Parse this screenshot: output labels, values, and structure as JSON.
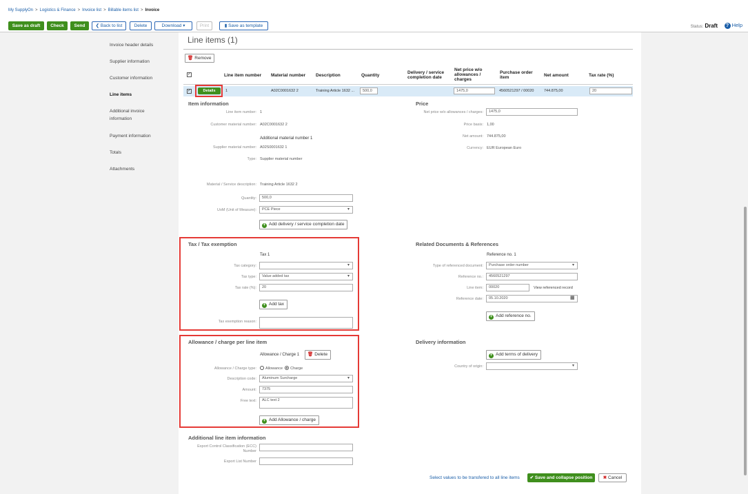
{
  "breadcrumb": {
    "items": [
      "My SupplyOn",
      "Logistics & Finance",
      "Invoice list",
      "Billable items list"
    ],
    "current": "Invoice"
  },
  "toolbar": {
    "save_draft": "Save as draft",
    "check": "Check",
    "send": "Send",
    "back": "Back to list",
    "delete": "Delete",
    "download": "Download",
    "print": "Print",
    "save_template": "Save as template"
  },
  "status": {
    "label": "Status:",
    "value": "Draft"
  },
  "help": "Help",
  "sidebar": {
    "items": [
      {
        "label": "Invoice header details"
      },
      {
        "label": "Supplier information"
      },
      {
        "label": "Customer information"
      },
      {
        "label": "Line items",
        "active": true
      },
      {
        "label": "Additional invoice information"
      },
      {
        "label": "Payment information"
      },
      {
        "label": "Totals"
      },
      {
        "label": "Attachments"
      }
    ]
  },
  "line_items": {
    "title": "Line items (1)",
    "remove": "Remove",
    "columns": [
      "Line item number",
      "Material number",
      "Description",
      "Quantity",
      "Delivery / service completion date",
      "Net price w/o allowances / charges",
      "Purchase order item",
      "Net amount",
      "Tax rate (%)"
    ],
    "row": {
      "details": "Details",
      "number": "1",
      "material": "A02C0001632 2",
      "description": "Training Article 1632 ...",
      "quantity": "500,0",
      "net_price": "1475,0",
      "po_item": "4560521297 / 00020",
      "net_amount": "744.875,00",
      "tax_rate": "20"
    }
  },
  "item_info": {
    "title": "Item information",
    "line_item_number_label": "Line item number:",
    "line_item_number": "1",
    "customer_material_label": "Customer material number:",
    "customer_material": "A02C0001632 2",
    "additional_material_title": "Additional material number 1",
    "supplier_material_label": "Supplier material number:",
    "supplier_material": "A02S0001632 1",
    "type_label": "Type:",
    "type": "Supplier material number",
    "description_label": "Material / Service description:",
    "description": "Training Article 1632 2",
    "quantity_label": "Quantity:",
    "quantity": "500,0",
    "uom_label": "UoM (Unit of Measure):",
    "uom": "PCE  Piece",
    "add_delivery": "Add delivery / service completion date"
  },
  "price": {
    "title": "Price",
    "net_price_label": "Net price w/o allowances / charges:",
    "net_price": "1475,0",
    "price_basis_label": "Price basis:",
    "price_basis": "1,00",
    "net_amount_label": "Net amount:",
    "net_amount": "744.875,00",
    "currency_label": "Currency:",
    "currency": "EUR  European Euro"
  },
  "tax": {
    "title": "Tax / Tax exemption",
    "sub": "Tax 1",
    "category_label": "Tax category:",
    "category": "",
    "type_label": "Tax type:",
    "type": "Value added tax",
    "rate_label": "Tax rate (%):",
    "rate": "20",
    "add_tax": "Add tax",
    "exemption_label": "Tax exemption reason:",
    "exemption": ""
  },
  "related": {
    "title": "Related Documents & References",
    "sub": "Reference no. 1",
    "doc_type_label": "Type of referenced document:",
    "doc_type": "Purchase order number",
    "ref_no_label": "Reference no.:",
    "ref_no": "4560521297",
    "line_item_label": "Line item:",
    "line_item": "00020",
    "view_record": "View referenced record",
    "ref_date_label": "Reference date:",
    "ref_date": "05.10.2020",
    "add_ref": "Add reference no."
  },
  "allowance": {
    "title": "Allowance / charge per line item",
    "sub": "Allowance / Charge 1",
    "delete": "Delete",
    "type_label": "Allowance / Charge type:",
    "opt_allowance": "Allowance",
    "opt_charge": "Charge",
    "code_label": "Description code:",
    "code": "Aluminum Surcharge",
    "amount_label": "Amount:",
    "amount": "7375",
    "free_text_label": "Free text:",
    "free_text": "ALC text 2",
    "add": "Add Allowance / charge"
  },
  "delivery": {
    "title": "Delivery information",
    "add_terms": "Add terms of delivery",
    "country_label": "Country of origin:",
    "country": ""
  },
  "additional": {
    "title": "Additional line item information",
    "eccn_label": "Export Control Classification (ECC) Number",
    "export_list_label": "Export List Number"
  },
  "footer": {
    "transfer": "Select values to be transfered to all line items",
    "save_collapse": "Save and collapse position",
    "cancel": "Cancel"
  },
  "colors": {
    "green": "#3f8f1d",
    "blue": "#1a5ea8",
    "highlight_red": "#e53935",
    "row_blue": "#d9eaf7"
  }
}
